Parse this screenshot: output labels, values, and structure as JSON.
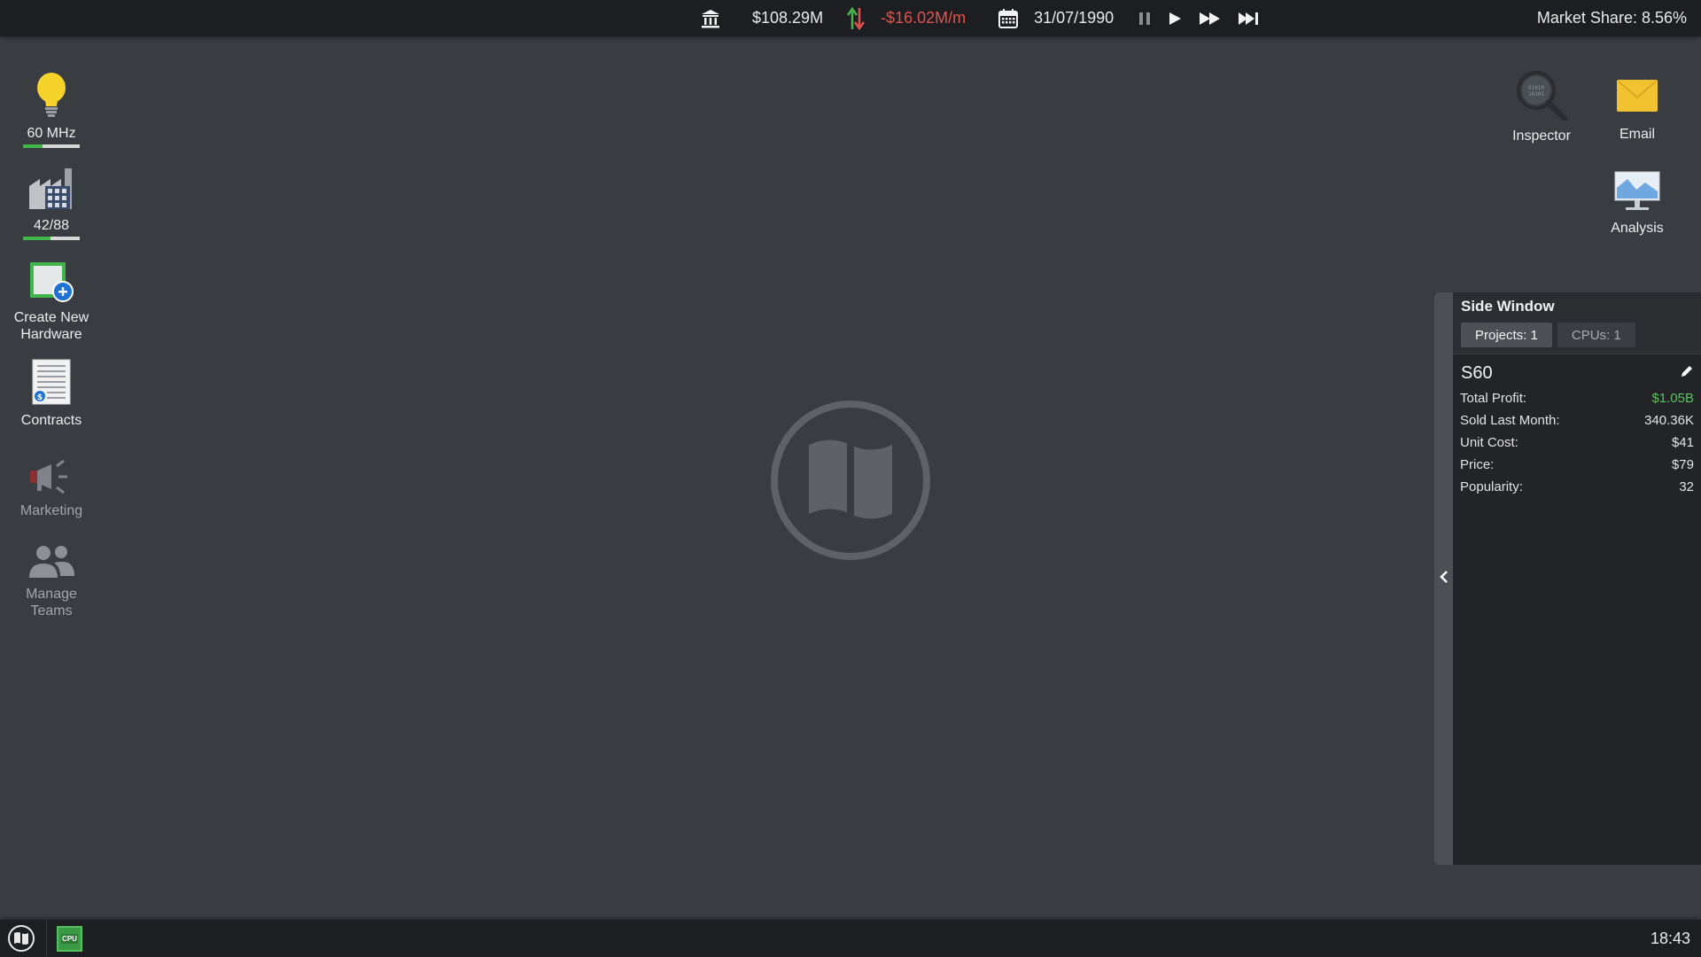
{
  "topbar": {
    "funds": "$108.29M",
    "cashflow": "-$16.02M/m",
    "date": "31/07/1990",
    "market_share": "Market Share: 8.56%",
    "icons": [
      "bank-icon",
      "cashflow-arrows-icon",
      "calendar-icon",
      "pause-icon",
      "play-icon",
      "fast-forward-icon",
      "fastest-forward-icon"
    ]
  },
  "left_icons": [
    {
      "label": "60 MHz",
      "icon": "lightbulb-icon",
      "progress": 0.35
    },
    {
      "label": "42/88",
      "icon": "factory-icon",
      "progress": 0.48
    },
    {
      "label": "Create New Hardware",
      "icon": "create-hardware-icon"
    },
    {
      "label": "Contracts",
      "icon": "contracts-icon"
    },
    {
      "label": "Marketing",
      "icon": "megaphone-icon"
    },
    {
      "label": "Manage Teams",
      "icon": "people-icon"
    }
  ],
  "right_icons": [
    {
      "label": "Inspector",
      "icon": "magnifier-icon"
    },
    {
      "label": "Email",
      "icon": "envelope-icon"
    },
    {
      "label": "Analysis",
      "icon": "monitor-chart-icon"
    }
  ],
  "side_window": {
    "title": "Side Window",
    "tabs": [
      "Projects: 1",
      "CPUs: 1"
    ],
    "project": {
      "name": "S60",
      "stats": [
        {
          "label": "Total Profit:",
          "value": "$1.05B"
        },
        {
          "label": "Sold Last Month:",
          "value": "340.36K"
        },
        {
          "label": "Unit Cost:",
          "value": "$41"
        },
        {
          "label": "Price:",
          "value": "$79"
        },
        {
          "label": "Popularity:",
          "value": "32"
        }
      ]
    }
  },
  "taskbar": {
    "cpu_label": "CPU",
    "clock": "18:43"
  },
  "colors": {
    "background": "#393c41",
    "bar": "#1d1e21",
    "negative": "#e2524c",
    "positive": "#59c35a",
    "accent_green": "#3fb54a"
  }
}
